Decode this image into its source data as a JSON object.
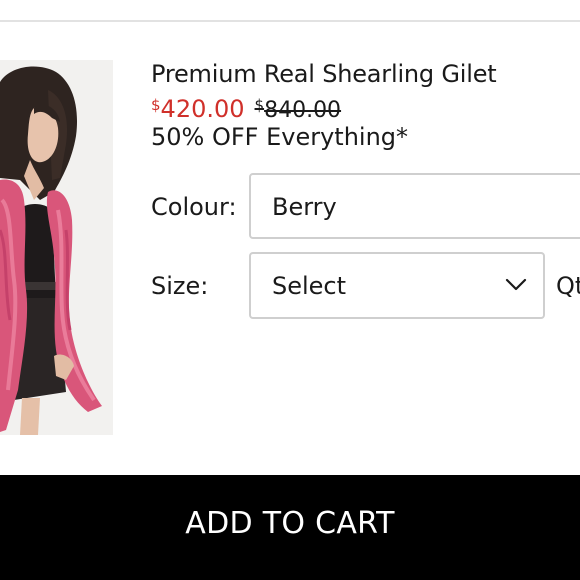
{
  "product": {
    "title": "Premium Real Shearling Gilet",
    "sale_currency": "$",
    "sale_amount": "420.00",
    "original_currency": "$",
    "original_amount": "840.00",
    "promo": "50% OFF Everything*"
  },
  "options": {
    "colour_label": "Colour:",
    "colour_value": "Berry",
    "size_label": "Size:",
    "size_value": "Select",
    "qty_label": "Qty"
  },
  "actions": {
    "add_to_cart_label": "ADD TO CART"
  },
  "icons": {
    "size_dropdown": "chevron-down-icon"
  },
  "colors": {
    "sale_price": "#d0302a",
    "cart_button_bg": "#000000",
    "cart_button_text": "#ffffff",
    "border": "#cfcfcf"
  }
}
